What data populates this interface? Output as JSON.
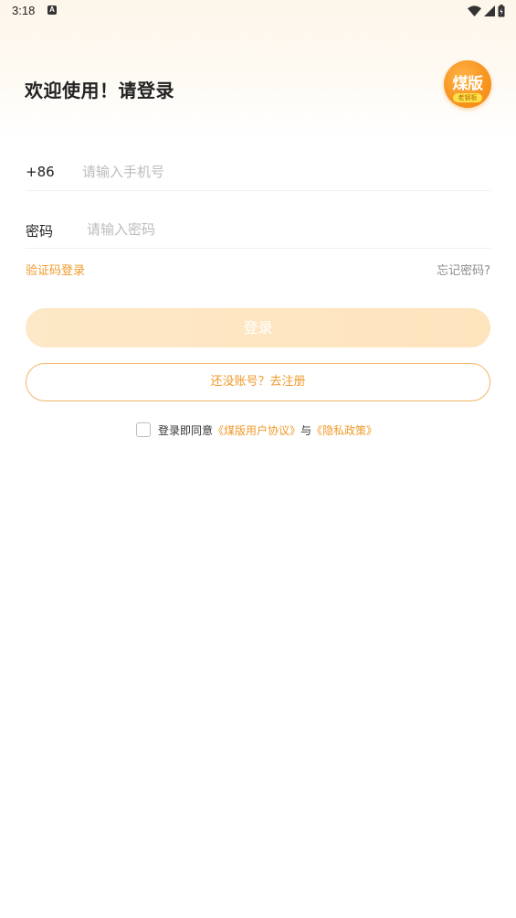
{
  "status_bar": {
    "time": "3:18",
    "notification_icon": "a-icon",
    "wifi_icon": "wifi-icon",
    "signal_icon": "signal-icon",
    "battery_icon": "battery-icon"
  },
  "header": {
    "title": "欢迎使用！请登录",
    "logo_text": "煤版",
    "logo_tag": "老钢板"
  },
  "form": {
    "phone_prefix": "+86",
    "phone_placeholder": "请输入手机号",
    "phone_value": "",
    "password_label": "密码",
    "password_placeholder": "请输入密码",
    "password_value": "",
    "code_login_link": "验证码登录",
    "forgot_password_link": "忘记密码?",
    "login_button": "登录",
    "register_button": "还没账号？去注册"
  },
  "agreement": {
    "prefix": "登录即同意",
    "user_agreement": "《煤版用户协议》",
    "conjunction": "与",
    "privacy_policy": "《隐私政策》",
    "checked": false
  },
  "colors": {
    "accent": "#f09a2a",
    "login_button_bg": "#fde8c7",
    "register_border": "#f3b56a",
    "header_bg": "#fdf6ea"
  }
}
